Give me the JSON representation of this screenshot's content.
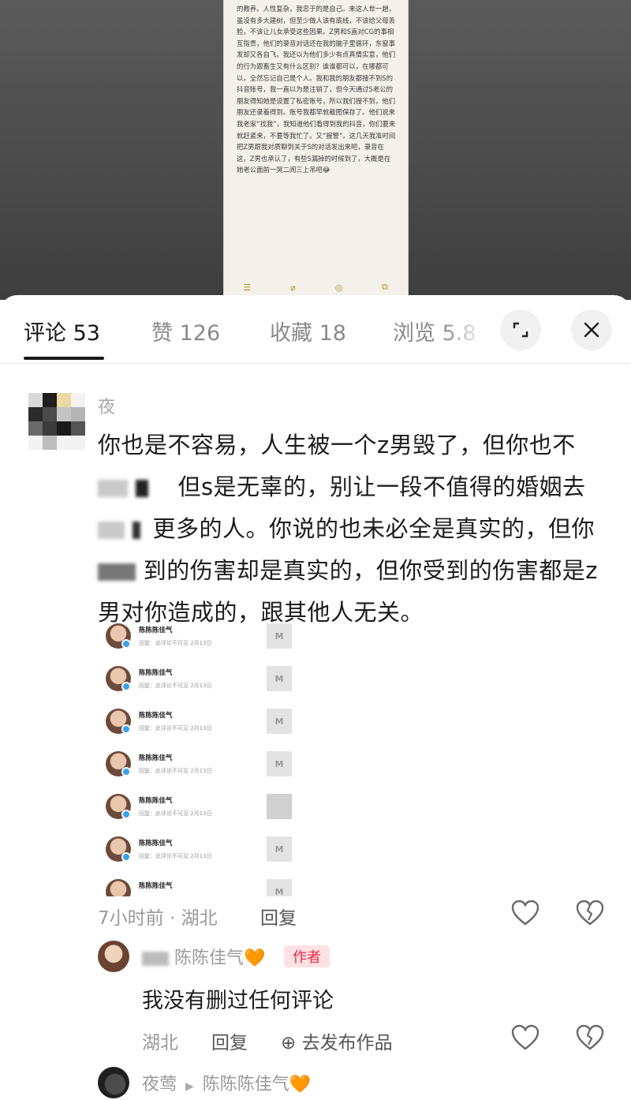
{
  "note": {
    "text": "的教养。人性复杂，我忠于的是自己。来这人世一趟，虽没有多大建树，但至少做人该有底线，不该给父母丢脸，不该让儿女承受这些因果。Z男和S直对CG的事相互指责，他们的录音对话还在我的脑子里循环，东窗事发却又各自飞。我还以为他们多少有点真情实意，他们的行为跟畜生又有什么区别？谁谁都可以，在哪都可以，全然忘记自己是个人。我和我的朋友都搜不到S的抖音账号，我一直以为是注销了，但今天通过S老公的朋友得知她是设置了私密账号，所以我们搜不到，他们朋友还录着得到。账号我都早就截图保存了。他们说来我老家“找我”，我知道他们看得到我的抖音，你们要来就赶紧来，不要等我忙了。又“报警”。这几天我准时间把Z男跟我对质聊到关于S的对话发出来吧，录音在这，Z男也承认了，有些S漏掉的时候到了，大概是在她老公面前一哭二闹三上吊吧😂",
    "toolbar_icons": [
      "checklist-icon",
      "attach-icon",
      "mention-icon",
      "edit-icon"
    ]
  },
  "tabs": [
    {
      "label": "评论 53"
    },
    {
      "label": "赞 126"
    },
    {
      "label": "收藏 18"
    },
    {
      "label": "浏览 5.8"
    }
  ],
  "comment": {
    "author": "夜",
    "line1": "你也是不容易，人生被一个z男毁了，但你也不",
    "line2": "但s是无辜的，别让一段不值得的婚姻去",
    "line3": "更多的人。你说的也未必全是真实的，但你",
    "line4": "到的伤害却是真实的，但你受到的伤害都是z",
    "line5": "男对你造成的，跟其他人无关。",
    "time_location": "7小时前 · 湖北",
    "reply_label": "回复"
  },
  "embed": {
    "name": "陈陈陈佳气",
    "rows": [
      {
        "sub": "回复：此评论不可见  2月13日"
      },
      {
        "sub": "回复：此评论不可见  2月13日"
      },
      {
        "sub": "回复：此评论不可见  2月13日"
      },
      {
        "sub": "回复：此评论不可见  2月13日"
      },
      {
        "sub": "回复：此评论不可见  2月13日"
      },
      {
        "sub": "回复：此评论不可见  2月13日"
      },
      {
        "sub": ""
      }
    ]
  },
  "reply": {
    "author": "陈陈佳气🧡",
    "badge": "作者",
    "body": "我没有删过任何评论",
    "location": "湖北",
    "reply_label": "回复",
    "go_publish": "去发布作品"
  },
  "reply2": {
    "author": "夜莺",
    "arrow": "▶",
    "target": "陈陈陈佳气🧡"
  },
  "colors": {
    "author_badge_bg": "#fde1e4",
    "author_badge_fg": "#ee2b47",
    "orange_heart": "#f5a623"
  }
}
